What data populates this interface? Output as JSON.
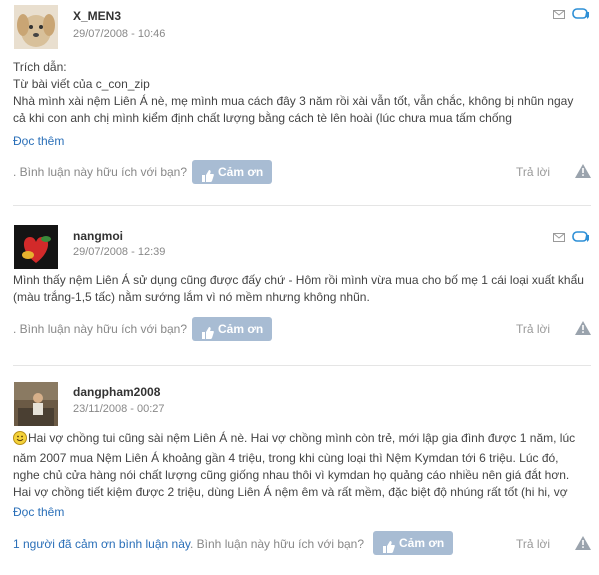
{
  "posts": [
    {
      "username": "X_MEN3",
      "date": "29/07/2008 - 10:46",
      "quote_label": "Trích dẫn:",
      "quote_source": "Từ bài viết của c_con_zip",
      "lines": [
        "Nhà mình xài nệm Liên Á nè, mẹ mình mua cách đây 3 năm rồi xài vẫn tốt, vẫn chắc, không bị nhũn ngay",
        "cả khi con anh chị mình kiểm định chất lượng bằng cách tè lên hoài (lúc chưa mua tấm chống"
      ],
      "read_more": "Đọc thêm",
      "helpful_text": ". Bình luận này hữu ích với bạn?",
      "thank_label": "Cảm ơn",
      "reply_label": "Trả lời"
    },
    {
      "username": "nangmoi",
      "date": "29/07/2008 - 12:39",
      "lines": [
        "Mình thấy nệm Liên Á sử dụng cũng được đấy chứ - Hôm rồi mình vừa mua cho bố mẹ 1 cái loại xuất khẩu",
        "(màu trắng-1,5 tấc) nằm sướng lắm vì nó mềm nhưng không nhũn."
      ],
      "helpful_text": ". Bình luận này hữu ích với bạn?",
      "thank_label": "Cảm ơn",
      "reply_label": "Trả lời"
    },
    {
      "username": "dangpham2008",
      "date": "23/11/2008 - 00:27",
      "lines": [
        "Hai vợ chồng tui cũng sài nệm Liên Á nè. Hai vợ chồng mình còn trẻ, mới lập gia đình được 1 năm, lúc",
        "năm 2007 mua Nệm Liên Á khoảng gần 4 triệu, trong khi cùng loại thì Nệm Kymdan tới 6 triệu. Lúc đó,",
        "nghe chủ cửa hàng nói chất lượng cũng giống nhau thôi vì kymdan họ quảng cáo nhiều nên giá đắt hơn.",
        "Hai vợ chồng tiết kiệm được 2 triệu, dùng Liên Á nệm êm và rất mềm, đặc biệt độ nhúng rất tốt (hi hi, vợ"
      ],
      "read_more": "Đọc thêm",
      "thanks_count_text": "1 người đã cảm ơn bình luận này",
      "helpful_text": ". Bình luận này hữu ích với bạn?",
      "thank_label": "Cảm ơn",
      "reply_label": "Trả lời"
    }
  ],
  "colors": {
    "link": "#2a6fb8",
    "button": "#a8bcd3",
    "muted": "#888888"
  }
}
